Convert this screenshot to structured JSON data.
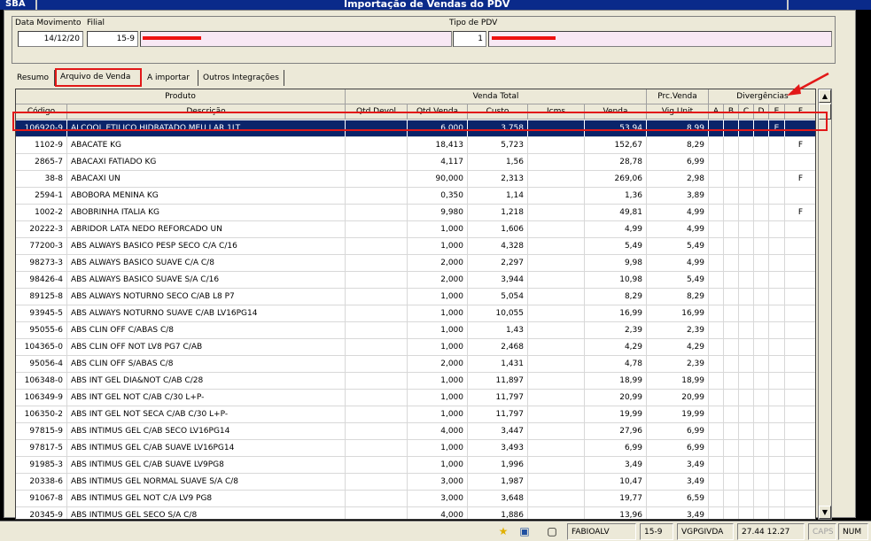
{
  "app": {
    "short_name": "SBA",
    "title": "Importação de Vendas do PDV"
  },
  "header": {
    "data_movimento_label": "Data Movimento",
    "data_movimento": "14/12/20",
    "filial_label": "Filial",
    "filial_code": "15-9",
    "tipo_pdv_label": "Tipo de PDV",
    "tipo_pdv_code": "1"
  },
  "tabs": [
    {
      "label": "Resumo"
    },
    {
      "label": "Arquivo de Venda"
    },
    {
      "label": "A importar"
    },
    {
      "label": "Outros Integrações"
    }
  ],
  "grid": {
    "group_headers": {
      "produto": "Produto",
      "venda_total": "Venda Total",
      "prc_venda": "Prc.Venda",
      "divergencias": "Divergências"
    },
    "columns": {
      "codigo": "Código",
      "descricao": "Descrição",
      "qtd_devol": "Qtd.Devol",
      "qtd_venda": "Qtd.Venda",
      "custo": "Custo",
      "icms": "Icms",
      "venda": "Venda",
      "vig_unit": "Vig.Unit",
      "a": "A",
      "b": "B",
      "c": "C",
      "d": "D",
      "e": "E",
      "f": "F"
    },
    "rows": [
      {
        "codigo": "106920-9",
        "descricao": "ALCOOL ETILICO HIDRATADO MEU LAR 1LT",
        "qtd_devol": "",
        "qtd_venda": "6,000",
        "custo": "3,758",
        "icms": "",
        "venda": "53,94",
        "vig_unit": "8,99",
        "a": "",
        "b": "",
        "c": "",
        "d": "",
        "e": "E",
        "f": ""
      },
      {
        "codigo": "1102-9",
        "descricao": "ABACATE KG",
        "qtd_devol": "",
        "qtd_venda": "18,413",
        "custo": "5,723",
        "icms": "",
        "venda": "152,67",
        "vig_unit": "8,29",
        "a": "",
        "b": "",
        "c": "",
        "d": "",
        "e": "",
        "f": "F"
      },
      {
        "codigo": "2865-7",
        "descricao": "ABACAXI FATIADO KG",
        "qtd_devol": "",
        "qtd_venda": "4,117",
        "custo": "1,56",
        "icms": "",
        "venda": "28,78",
        "vig_unit": "6,99",
        "a": "",
        "b": "",
        "c": "",
        "d": "",
        "e": "",
        "f": ""
      },
      {
        "codigo": "38-8",
        "descricao": "ABACAXI UN",
        "qtd_devol": "",
        "qtd_venda": "90,000",
        "custo": "2,313",
        "icms": "",
        "venda": "269,06",
        "vig_unit": "2,98",
        "a": "",
        "b": "",
        "c": "",
        "d": "",
        "e": "",
        "f": "F"
      },
      {
        "codigo": "2594-1",
        "descricao": "ABOBORA MENINA KG",
        "qtd_devol": "",
        "qtd_venda": "0,350",
        "custo": "1,14",
        "icms": "",
        "venda": "1,36",
        "vig_unit": "3,89",
        "a": "",
        "b": "",
        "c": "",
        "d": "",
        "e": "",
        "f": ""
      },
      {
        "codigo": "1002-2",
        "descricao": "ABOBRINHA ITALIA KG",
        "qtd_devol": "",
        "qtd_venda": "9,980",
        "custo": "1,218",
        "icms": "",
        "venda": "49,81",
        "vig_unit": "4,99",
        "a": "",
        "b": "",
        "c": "",
        "d": "",
        "e": "",
        "f": "F"
      },
      {
        "codigo": "20222-3",
        "descricao": "ABRIDOR LATA NEDO REFORCADO UN",
        "qtd_devol": "",
        "qtd_venda": "1,000",
        "custo": "1,606",
        "icms": "",
        "venda": "4,99",
        "vig_unit": "4,99",
        "a": "",
        "b": "",
        "c": "",
        "d": "",
        "e": "",
        "f": ""
      },
      {
        "codigo": "77200-3",
        "descricao": "ABS ALWAYS BASICO PESP SECO C/A C/16",
        "qtd_devol": "",
        "qtd_venda": "1,000",
        "custo": "4,328",
        "icms": "",
        "venda": "5,49",
        "vig_unit": "5,49",
        "a": "",
        "b": "",
        "c": "",
        "d": "",
        "e": "",
        "f": ""
      },
      {
        "codigo": "98273-3",
        "descricao": "ABS ALWAYS BASICO SUAVE C/A C/8",
        "qtd_devol": "",
        "qtd_venda": "2,000",
        "custo": "2,297",
        "icms": "",
        "venda": "9,98",
        "vig_unit": "4,99",
        "a": "",
        "b": "",
        "c": "",
        "d": "",
        "e": "",
        "f": ""
      },
      {
        "codigo": "98426-4",
        "descricao": "ABS ALWAYS BASICO SUAVE S/A C/16",
        "qtd_devol": "",
        "qtd_venda": "2,000",
        "custo": "3,944",
        "icms": "",
        "venda": "10,98",
        "vig_unit": "5,49",
        "a": "",
        "b": "",
        "c": "",
        "d": "",
        "e": "",
        "f": ""
      },
      {
        "codigo": "89125-8",
        "descricao": "ABS ALWAYS NOTURNO SECO C/AB L8 P7",
        "qtd_devol": "",
        "qtd_venda": "1,000",
        "custo": "5,054",
        "icms": "",
        "venda": "8,29",
        "vig_unit": "8,29",
        "a": "",
        "b": "",
        "c": "",
        "d": "",
        "e": "",
        "f": ""
      },
      {
        "codigo": "93945-5",
        "descricao": "ABS ALWAYS NOTURNO SUAVE C/AB LV16PG14",
        "qtd_devol": "",
        "qtd_venda": "1,000",
        "custo": "10,055",
        "icms": "",
        "venda": "16,99",
        "vig_unit": "16,99",
        "a": "",
        "b": "",
        "c": "",
        "d": "",
        "e": "",
        "f": ""
      },
      {
        "codigo": "95055-6",
        "descricao": "ABS CLIN OFF C/ABAS C/8",
        "qtd_devol": "",
        "qtd_venda": "1,000",
        "custo": "1,43",
        "icms": "",
        "venda": "2,39",
        "vig_unit": "2,39",
        "a": "",
        "b": "",
        "c": "",
        "d": "",
        "e": "",
        "f": ""
      },
      {
        "codigo": "104365-0",
        "descricao": "ABS CLIN OFF NOT LV8 PG7 C/AB",
        "qtd_devol": "",
        "qtd_venda": "1,000",
        "custo": "2,468",
        "icms": "",
        "venda": "4,29",
        "vig_unit": "4,29",
        "a": "",
        "b": "",
        "c": "",
        "d": "",
        "e": "",
        "f": ""
      },
      {
        "codigo": "95056-4",
        "descricao": "ABS CLIN OFF S/ABAS C/8",
        "qtd_devol": "",
        "qtd_venda": "2,000",
        "custo": "1,431",
        "icms": "",
        "venda": "4,78",
        "vig_unit": "2,39",
        "a": "",
        "b": "",
        "c": "",
        "d": "",
        "e": "",
        "f": ""
      },
      {
        "codigo": "106348-0",
        "descricao": "ABS INT GEL DIA&NOT C/AB C/28",
        "qtd_devol": "",
        "qtd_venda": "1,000",
        "custo": "11,897",
        "icms": "",
        "venda": "18,99",
        "vig_unit": "18,99",
        "a": "",
        "b": "",
        "c": "",
        "d": "",
        "e": "",
        "f": ""
      },
      {
        "codigo": "106349-9",
        "descricao": "ABS INT GEL NOT C/AB C/30 L+P-",
        "qtd_devol": "",
        "qtd_venda": "1,000",
        "custo": "11,797",
        "icms": "",
        "venda": "20,99",
        "vig_unit": "20,99",
        "a": "",
        "b": "",
        "c": "",
        "d": "",
        "e": "",
        "f": ""
      },
      {
        "codigo": "106350-2",
        "descricao": "ABS INT GEL NOT SECA C/AB C/30 L+P-",
        "qtd_devol": "",
        "qtd_venda": "1,000",
        "custo": "11,797",
        "icms": "",
        "venda": "19,99",
        "vig_unit": "19,99",
        "a": "",
        "b": "",
        "c": "",
        "d": "",
        "e": "",
        "f": ""
      },
      {
        "codigo": "97815-9",
        "descricao": "ABS INTIMUS GEL C/AB SECO LV16PG14",
        "qtd_devol": "",
        "qtd_venda": "4,000",
        "custo": "3,447",
        "icms": "",
        "venda": "27,96",
        "vig_unit": "6,99",
        "a": "",
        "b": "",
        "c": "",
        "d": "",
        "e": "",
        "f": ""
      },
      {
        "codigo": "97817-5",
        "descricao": "ABS INTIMUS GEL C/AB SUAVE LV16PG14",
        "qtd_devol": "",
        "qtd_venda": "1,000",
        "custo": "3,493",
        "icms": "",
        "venda": "6,99",
        "vig_unit": "6,99",
        "a": "",
        "b": "",
        "c": "",
        "d": "",
        "e": "",
        "f": ""
      },
      {
        "codigo": "91985-3",
        "descricao": "ABS INTIMUS GEL C/AB SUAVE LV9PG8",
        "qtd_devol": "",
        "qtd_venda": "1,000",
        "custo": "1,996",
        "icms": "",
        "venda": "3,49",
        "vig_unit": "3,49",
        "a": "",
        "b": "",
        "c": "",
        "d": "",
        "e": "",
        "f": ""
      },
      {
        "codigo": "20338-6",
        "descricao": "ABS INTIMUS GEL NORMAL SUAVE S/A C/8",
        "qtd_devol": "",
        "qtd_venda": "3,000",
        "custo": "1,987",
        "icms": "",
        "venda": "10,47",
        "vig_unit": "3,49",
        "a": "",
        "b": "",
        "c": "",
        "d": "",
        "e": "",
        "f": ""
      },
      {
        "codigo": "91067-8",
        "descricao": "ABS INTIMUS GEL NOT C/A  LV9 PG8",
        "qtd_devol": "",
        "qtd_venda": "3,000",
        "custo": "3,648",
        "icms": "",
        "venda": "19,77",
        "vig_unit": "6,59",
        "a": "",
        "b": "",
        "c": "",
        "d": "",
        "e": "",
        "f": ""
      },
      {
        "codigo": "20345-9",
        "descricao": "ABS INTIMUS GEL SECO S/A C/8",
        "qtd_devol": "",
        "qtd_venda": "4,000",
        "custo": "1,886",
        "icms": "",
        "venda": "13,96",
        "vig_unit": "3,49",
        "a": "",
        "b": "",
        "c": "",
        "d": "",
        "e": "",
        "f": ""
      }
    ]
  },
  "status": {
    "icons": [
      "star-icon",
      "user-card-icon",
      "clipboard-icon"
    ],
    "user": "FABIOALV",
    "filial": "15-9",
    "module": "VGPGIVDA",
    "time": "27.44 12.27",
    "caps": "CAPS",
    "num": "NUM"
  },
  "colors": {
    "selection": "#0a246a",
    "highlight_red": "#e21818",
    "titlebar": "#0a2a8a"
  }
}
